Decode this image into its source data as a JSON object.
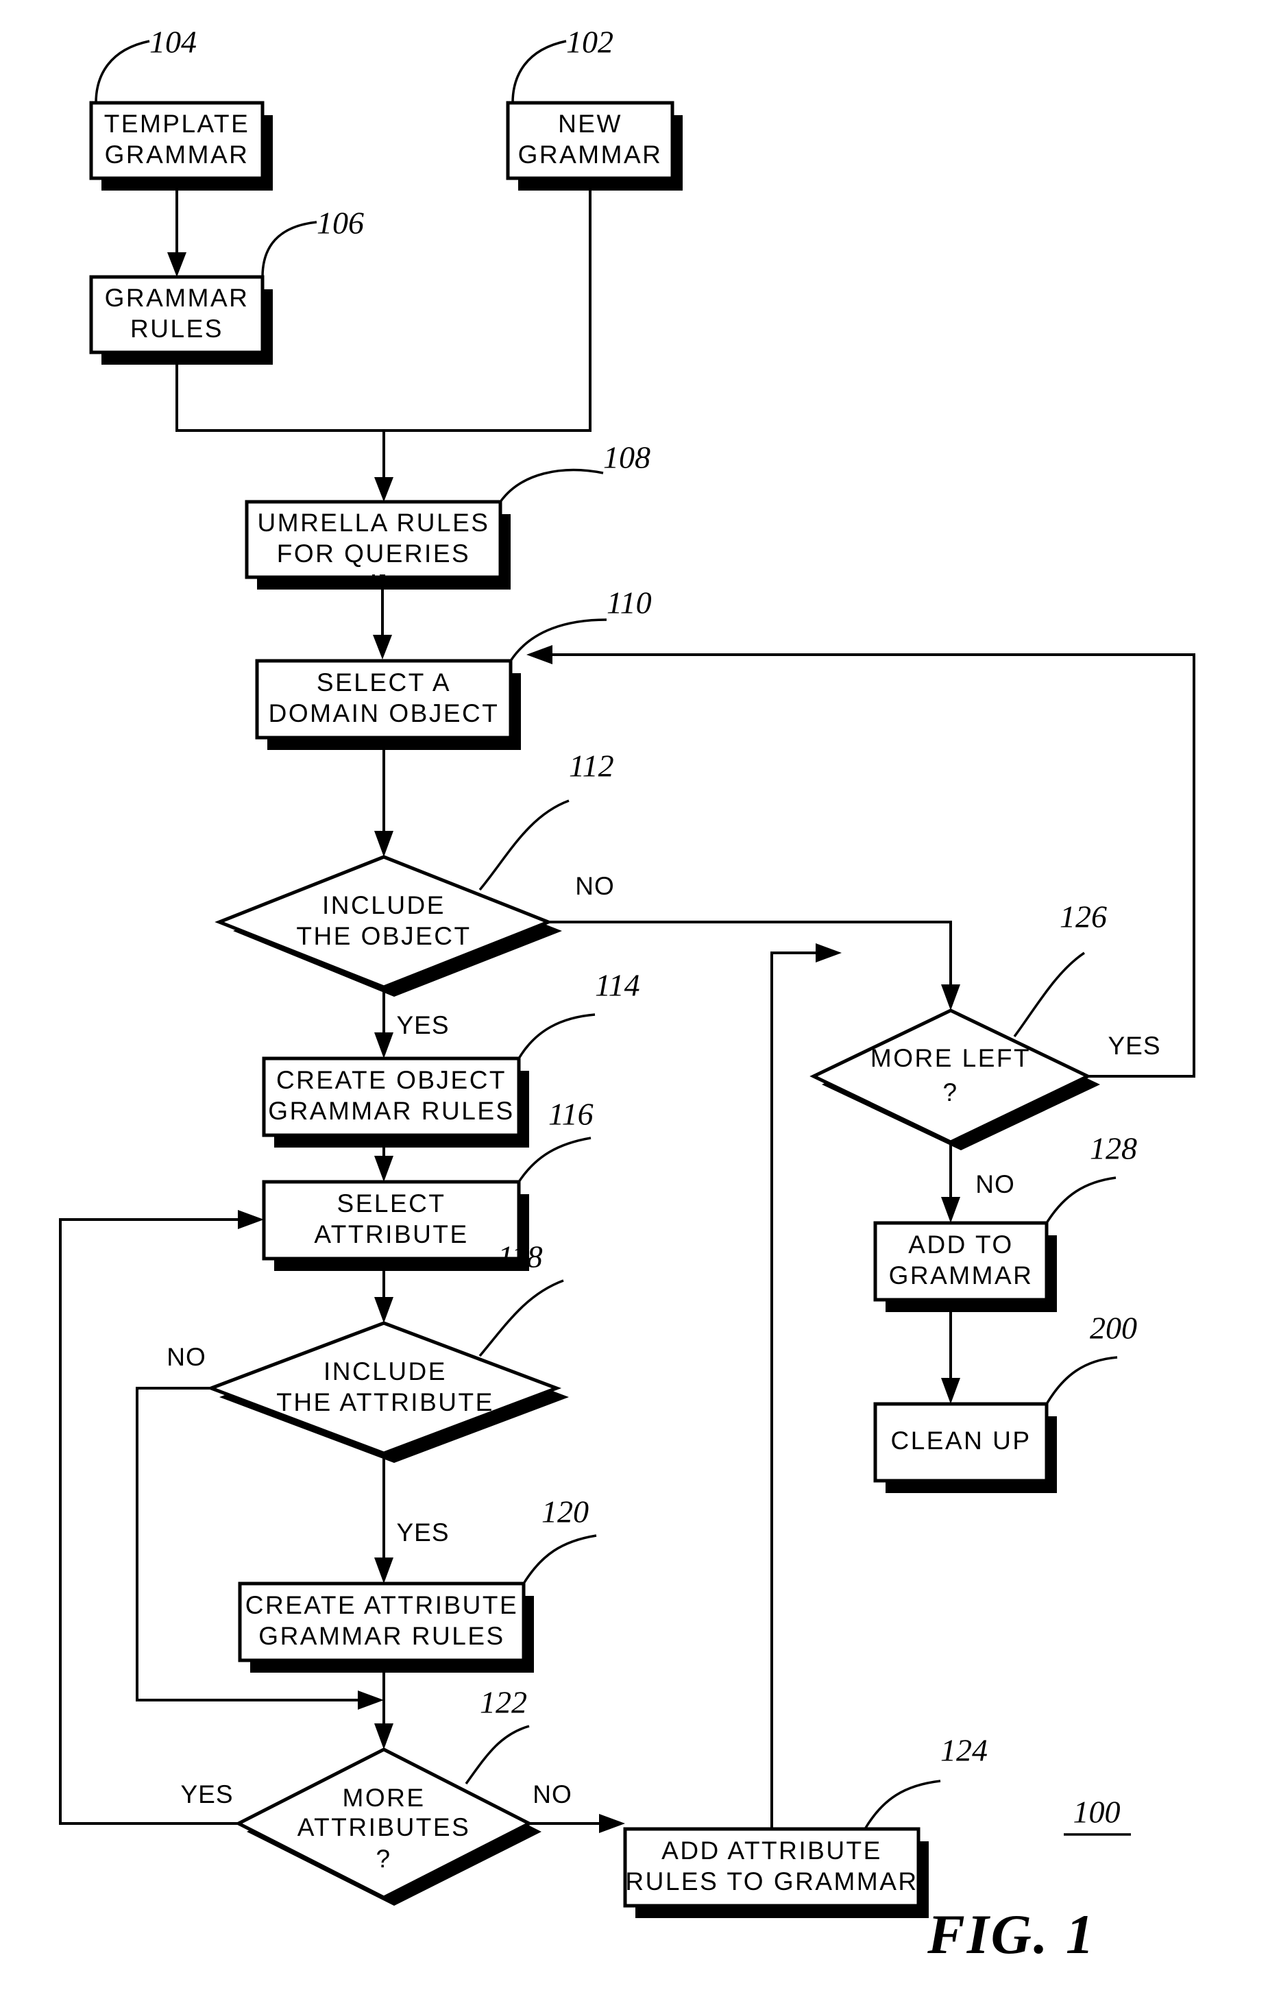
{
  "figure": {
    "caption": "FIG. 1",
    "system_ref": "100"
  },
  "nodes": [
    {
      "id": "n102",
      "ref": "102",
      "shape": "box",
      "lines": [
        "NEW",
        "GRAMMAR"
      ]
    },
    {
      "id": "n104",
      "ref": "104",
      "shape": "box",
      "lines": [
        "TEMPLATE",
        "GRAMMAR"
      ]
    },
    {
      "id": "n106",
      "ref": "106",
      "shape": "box",
      "lines": [
        "GRAMMAR",
        "RULES"
      ]
    },
    {
      "id": "n108",
      "ref": "108",
      "shape": "box",
      "lines": [
        "UMRELLA RULES",
        "FOR QUERIES"
      ]
    },
    {
      "id": "n110",
      "ref": "110",
      "shape": "box",
      "lines": [
        "SELECT A",
        "DOMAIN OBJECT"
      ]
    },
    {
      "id": "n112",
      "ref": "112",
      "shape": "diamond",
      "lines": [
        "INCLUDE",
        "THE OBJECT"
      ]
    },
    {
      "id": "n114",
      "ref": "114",
      "shape": "box",
      "lines": [
        "CREATE OBJECT",
        "GRAMMAR RULES"
      ]
    },
    {
      "id": "n116",
      "ref": "116",
      "shape": "box",
      "lines": [
        "SELECT",
        "ATTRIBUTE"
      ]
    },
    {
      "id": "n118",
      "ref": "118",
      "shape": "diamond",
      "lines": [
        "INCLUDE",
        "THE ATTRIBUTE"
      ]
    },
    {
      "id": "n120",
      "ref": "120",
      "shape": "box",
      "lines": [
        "CREATE ATTRIBUTE",
        "GRAMMAR RULES"
      ]
    },
    {
      "id": "n122",
      "ref": "122",
      "shape": "diamond",
      "lines": [
        "MORE",
        "ATTRIBUTES",
        "?"
      ]
    },
    {
      "id": "n124",
      "ref": "124",
      "shape": "box",
      "lines": [
        "ADD ATTRIBUTE",
        "RULES TO GRAMMAR"
      ]
    },
    {
      "id": "n126",
      "ref": "126",
      "shape": "diamond",
      "lines": [
        "MORE LEFT",
        "?"
      ]
    },
    {
      "id": "n128",
      "ref": "128",
      "shape": "box",
      "lines": [
        "ADD TO",
        "GRAMMAR"
      ]
    },
    {
      "id": "n200",
      "ref": "200",
      "shape": "box",
      "lines": [
        "CLEAN UP"
      ]
    }
  ],
  "edge_labels": {
    "obj_no": "NO",
    "obj_yes": "YES",
    "attr_no": "NO",
    "attr_yes": "YES",
    "more_attr_yes": "YES",
    "more_attr_no": "NO",
    "more_left_yes": "YES",
    "more_left_no": "NO"
  },
  "colors": {
    "ink": "#000000",
    "paper": "#ffffff"
  }
}
